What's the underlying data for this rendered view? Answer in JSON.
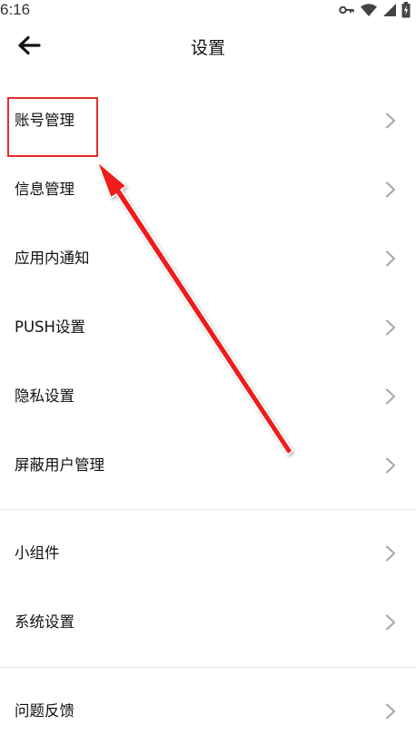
{
  "status_bar": {
    "time": "6:16",
    "icons": [
      "key-icon",
      "wifi-icon",
      "signal-icon",
      "battery-charging-icon"
    ]
  },
  "header": {
    "title": "设置",
    "back_icon": "arrow-left-icon"
  },
  "settings_groups": [
    {
      "items": [
        {
          "label": "账号管理"
        },
        {
          "label": "信息管理"
        },
        {
          "label": "应用内通知"
        },
        {
          "label": "PUSH设置"
        },
        {
          "label": "隐私设置"
        },
        {
          "label": "屏蔽用户管理"
        }
      ]
    },
    {
      "items": [
        {
          "label": "小组件"
        },
        {
          "label": "系统设置"
        }
      ]
    },
    {
      "items": [
        {
          "label": "问题反馈"
        }
      ]
    }
  ],
  "annotation": {
    "highlighted_item": "账号管理",
    "color": "#e82b2b"
  },
  "colors": {
    "text": "#111111",
    "chevron": "#a9a9a9",
    "divider": "#e7e7e7",
    "annotation": "#e82b2b"
  }
}
